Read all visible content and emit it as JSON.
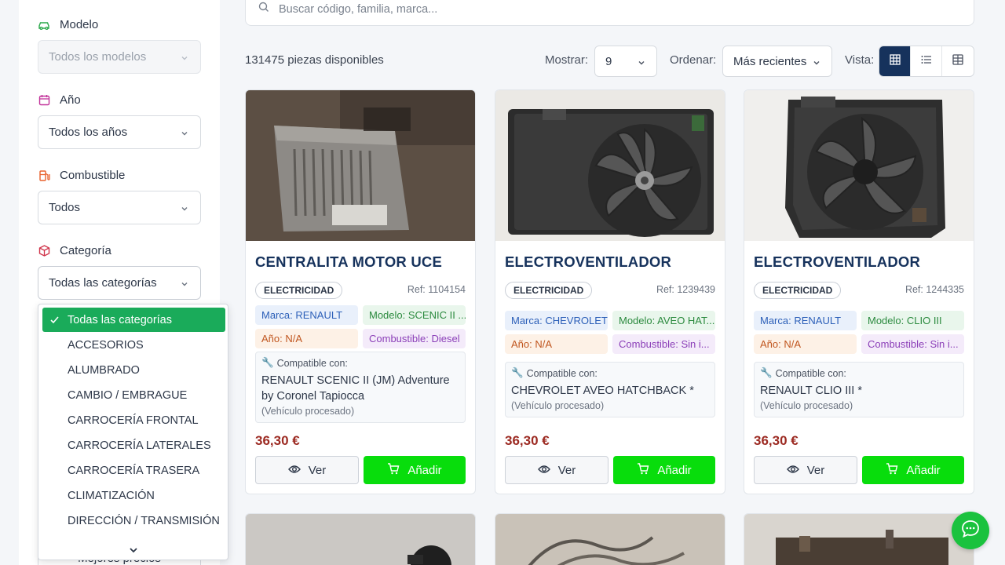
{
  "filters": {
    "modelo": {
      "label": "Modelo",
      "value": "Todos los modelos"
    },
    "anio": {
      "label": "Año",
      "value": "Todos los años"
    },
    "combustible": {
      "label": "Combustible",
      "value": "Todos"
    },
    "categoria": {
      "label": "Categoría",
      "value": "Todas las categorías"
    },
    "under_select_text": "Mejores precios"
  },
  "category_dropdown": {
    "options": [
      "Todas las categorías",
      "ACCESORIOS",
      "ALUMBRADO",
      "CAMBIO / EMBRAGUE",
      "CARROCERÍA FRONTAL",
      "CARROCERÍA LATERALES",
      "CARROCERÍA TRASERA",
      "CLIMATIZACIÓN",
      "DIRECCIÓN / TRANSMISIÓN"
    ],
    "selected_index": 0
  },
  "search": {
    "placeholder": "Buscar código, familia, marca..."
  },
  "toolbar": {
    "count": "131475 piezas disponibles",
    "mostrar_label": "Mostrar:",
    "mostrar_value": "9",
    "ordenar_label": "Ordenar:",
    "ordenar_value": "Más recientes",
    "vista_label": "Vista:",
    "active_view": "grid"
  },
  "products": [
    {
      "title": "CENTRALITA MOTOR UCE",
      "category": "ELECTRICIDAD",
      "ref": "Ref: 1104154",
      "marca": "Marca: RENAULT",
      "modelo": "Modelo: SCENIC II ...",
      "anio": "Año: N/A",
      "combustible": "Combustible: Diesel",
      "compat_label": "Compatible con:",
      "vehicle": "RENAULT SCENIC II (JM) Adventure by Coronel Tapiocca",
      "processed": "(Vehículo procesado)",
      "price": "36,30 €",
      "ver_label": "Ver",
      "add_label": "Añadir"
    },
    {
      "title": "ELECTROVENTILADOR",
      "category": "ELECTRICIDAD",
      "ref": "Ref: 1239439",
      "marca": "Marca: CHEVROLET",
      "modelo": "Modelo: AVEO HAT...",
      "anio": "Año: N/A",
      "combustible": "Combustible: Sin i...",
      "compat_label": "Compatible con:",
      "vehicle": "CHEVROLET AVEO HATCHBACK *",
      "processed": "(Vehículo procesado)",
      "price": "36,30 €",
      "ver_label": "Ver",
      "add_label": "Añadir"
    },
    {
      "title": "ELECTROVENTILADOR",
      "category": "ELECTRICIDAD",
      "ref": "Ref: 1244335",
      "marca": "Marca: RENAULT",
      "modelo": "Modelo: CLIO III",
      "anio": "Año: N/A",
      "combustible": "Combustible: Sin i...",
      "compat_label": "Compatible con:",
      "vehicle": "RENAULT CLIO III *",
      "processed": "(Vehículo procesado)",
      "price": "36,30 €",
      "ver_label": "Ver",
      "add_label": "Añadir"
    }
  ],
  "colors": {
    "brand_navy": "#16325c",
    "add_green": "#08dd0c",
    "select_green": "#1aab5a",
    "price_red": "#9c2a22",
    "chat_green": "#1ac23e"
  },
  "icons": {
    "modelo": "car-icon",
    "anio": "calendar-icon",
    "combustible": "fuel-icon",
    "categoria": "box-icon",
    "search": "search-icon",
    "chat": "chat-icon"
  }
}
